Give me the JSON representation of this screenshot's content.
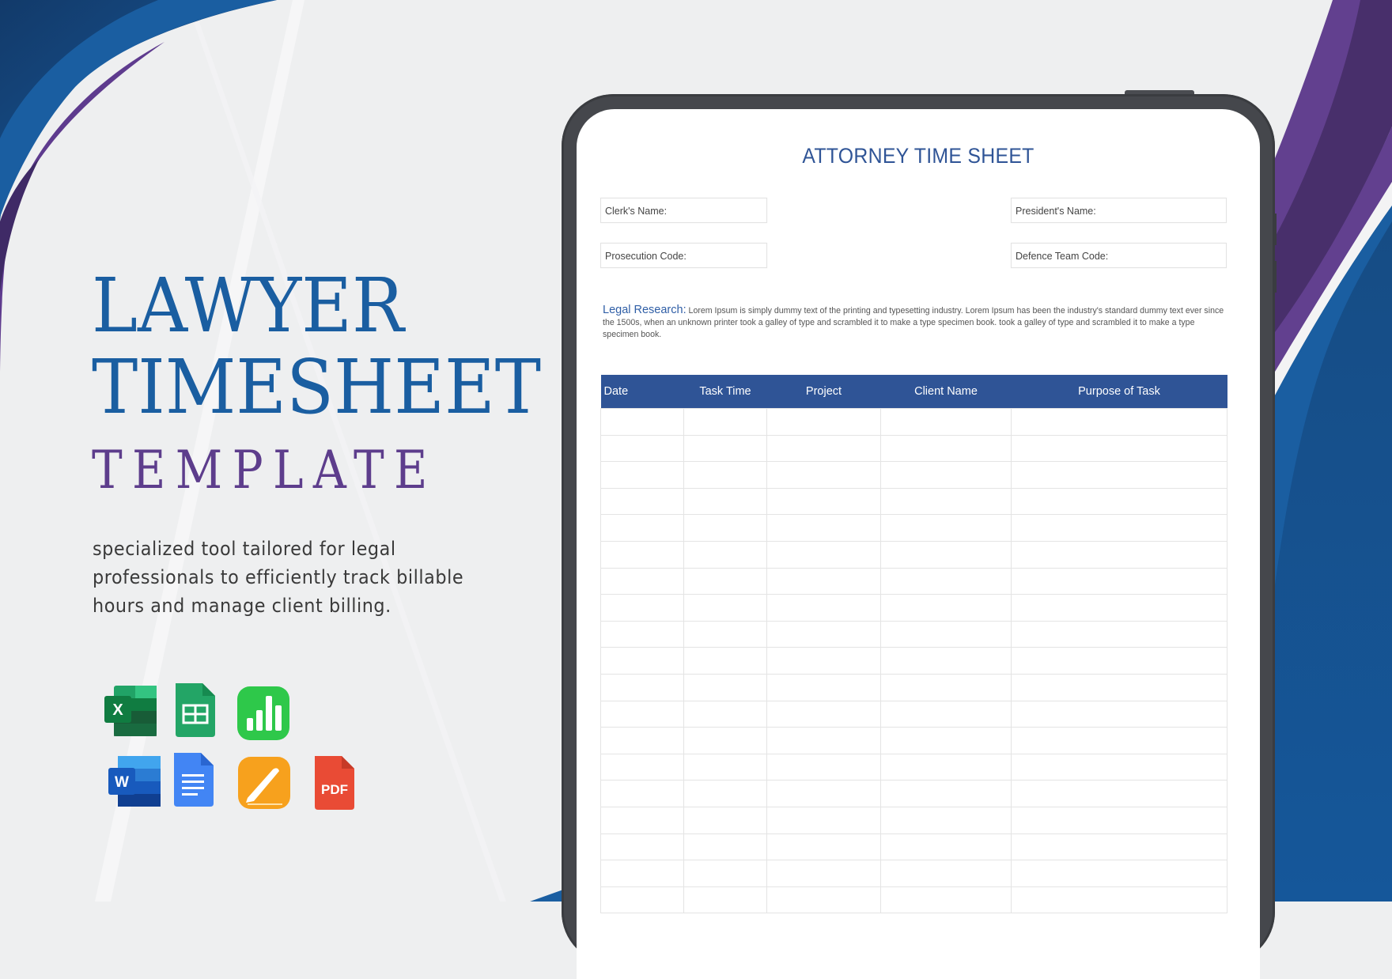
{
  "hero": {
    "title_line1": "LAWYER",
    "title_line2": "TIMESHEET",
    "title_line3": "TEMPLATE",
    "tagline": "specialized tool tailored for legal professionals to efficiently track billable hours and manage client billing.",
    "colors": {
      "title": "#1a5ea1",
      "subtitle": "#5d3d8c",
      "accent_blue": "#1a5ea1",
      "accent_purple": "#5e3b8e"
    }
  },
  "app_icons": [
    {
      "name": "excel-icon",
      "glyph": "X"
    },
    {
      "name": "google-sheets-icon",
      "glyph": ""
    },
    {
      "name": "numbers-icon",
      "glyph": ""
    },
    {
      "name": "word-icon",
      "glyph": "W"
    },
    {
      "name": "google-docs-icon",
      "glyph": ""
    },
    {
      "name": "pages-icon",
      "glyph": ""
    },
    {
      "name": "pdf-icon",
      "glyph": "PDF"
    }
  ],
  "document": {
    "title": "ATTORNEY TIME SHEET",
    "fields": {
      "clerk_name": "Clerk's Name:",
      "president_name": "President's Name:",
      "prosecution_code": "Prosecution Code:",
      "defence_team_code": "Defence Team Code:"
    },
    "legal_research": {
      "label": "Legal Research:",
      "text": "Lorem Ipsum is simply dummy text of the printing and typesetting industry. Lorem Ipsum has been the industry's standard dummy text ever since the 1500s, when an unknown printer took a galley of type and scrambled it to make a type specimen book. took a galley of type and scrambled it to make a type specimen book."
    },
    "table": {
      "columns": [
        "Date",
        "Task Time",
        "Project",
        "Client Name",
        "Purpose of Task"
      ],
      "visible_empty_rows": 19,
      "header_color": "#2f5496"
    }
  }
}
